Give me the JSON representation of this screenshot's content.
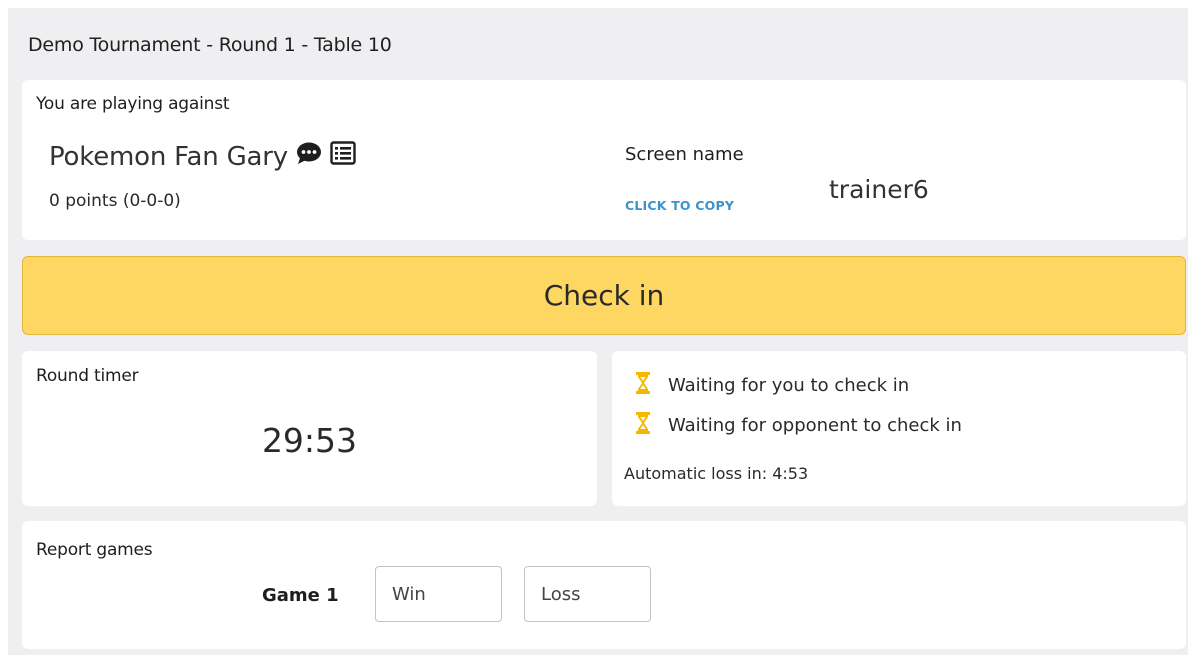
{
  "header": {
    "title": "Demo Tournament - Round 1 - Table 10"
  },
  "opponent": {
    "section_label": "You are playing against",
    "name": "Pokemon Fan Gary",
    "points": "0 points (0-0-0)",
    "icons": [
      "chat-bubble-icon",
      "list-icon"
    ],
    "screen_name_label": "Screen name",
    "copy_link": "CLICK TO COPY",
    "screen_name": "trainer6"
  },
  "checkin": {
    "label": "Check in",
    "color": "#fed763"
  },
  "timer": {
    "label": "Round timer",
    "value": "29:53"
  },
  "status": {
    "items": [
      {
        "icon": "hourglass-icon",
        "text": "Waiting for you to check in"
      },
      {
        "icon": "hourglass-icon",
        "text": "Waiting for opponent to check in"
      }
    ],
    "auto_loss": "Automatic loss in: 4:53",
    "icon_color": "#f5b800"
  },
  "report": {
    "label": "Report games",
    "game_label": "Game 1",
    "win_placeholder": "Win",
    "loss_placeholder": "Loss"
  },
  "colors": {
    "link": "#3b93c9",
    "background": "#efeff1"
  }
}
